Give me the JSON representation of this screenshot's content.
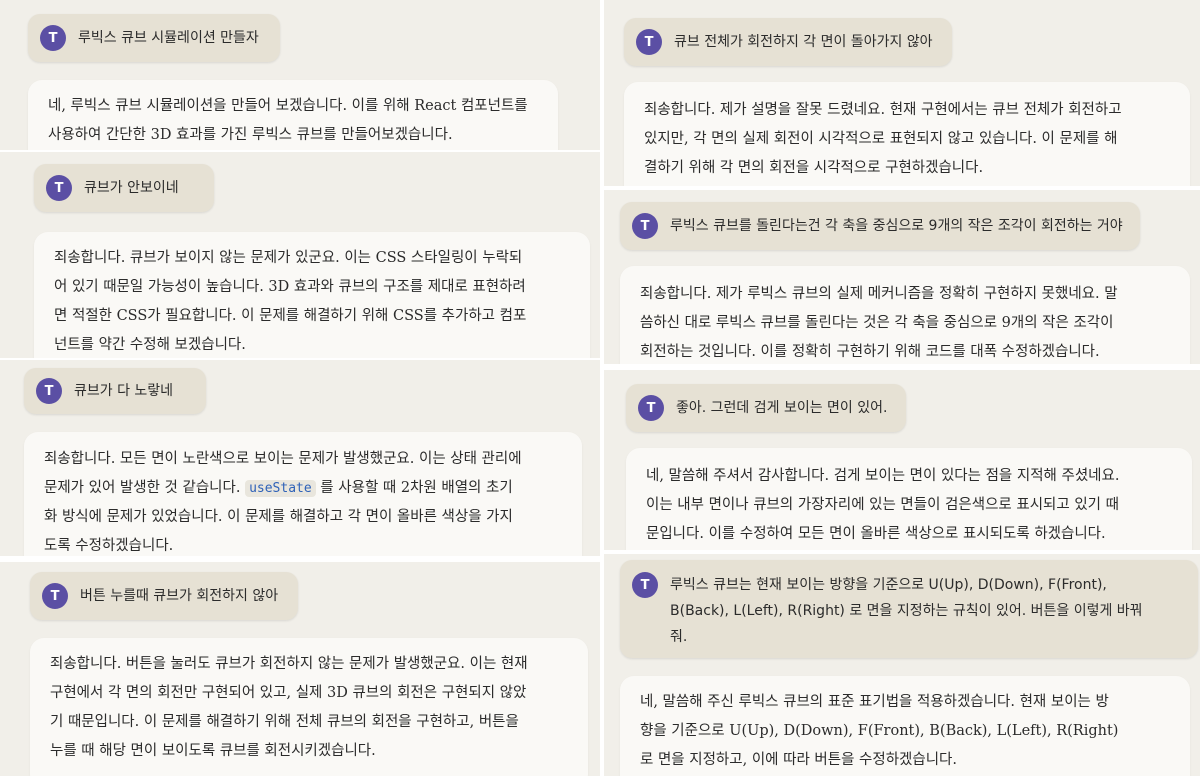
{
  "avatar": {
    "initial": "T"
  },
  "panels": [
    {
      "user": "루빅스 큐브 시뮬레이션 만들자",
      "reply": "네, 루빅스 큐브 시뮬레이션을 만들어 보겠습니다. 이를 위해 React 컴포넌트를\n사용하여 간단한 3D 효과를 가진 루빅스 큐브를 만들어보겠습니다."
    },
    {
      "user": "큐브가 안보이네",
      "reply": "죄송합니다. 큐브가 보이지 않는 문제가 있군요. 이는 CSS 스타일링이 누락되\n어 있기 때문일 가능성이 높습니다. 3D 효과와 큐브의 구조를 제대로 표현하려\n면 적절한 CSS가 필요합니다. 이 문제를 해결하기 위해 CSS를 추가하고 컴포\n넌트를 약간 수정해 보겠습니다."
    },
    {
      "user": "큐브가 다 노랗네",
      "reply_before": "죄송합니다. 모든 면이 노란색으로 보이는 문제가 발생했군요. 이는 상태 관리에\n문제가 있어 발생한 것 같습니다. ",
      "reply_code": "useState",
      "reply_after": " 를 사용할 때 2차원 배열의 초기\n화 방식에 문제가 있었습니다. 이 문제를 해결하고 각 면이 올바른 색상을 가지\n도록 수정하겠습니다."
    },
    {
      "user": "버튼 누를때 큐브가 회전하지 않아",
      "reply": "죄송합니다. 버튼을 눌러도 큐브가 회전하지 않는 문제가 발생했군요. 이는 현재\n구현에서 각 면의 회전만 구현되어 있고, 실제 3D 큐브의 회전은 구현되지 않았\n기 때문입니다. 이 문제를 해결하기 위해 전체 큐브의 회전을 구현하고, 버튼을\n누를 때 해당 면이 보이도록 큐브를 회전시키겠습니다."
    },
    {
      "user": "큐브 전체가 회전하지 각 면이 돌아가지 않아",
      "reply": "죄송합니다. 제가 설명을 잘못 드렸네요. 현재 구현에서는 큐브 전체가 회전하고\n있지만, 각 면의 실제 회전이 시각적으로 표현되지 않고 있습니다. 이 문제를 해\n결하기 위해 각 면의 회전을 시각적으로 구현하겠습니다."
    },
    {
      "user": "루빅스 큐브를 돌린다는건 각 축을 중심으로 9개의 작은 조각이 회전하는 거야",
      "reply": "죄송합니다. 제가 루빅스 큐브의 실제 메커니즘을 정확히 구현하지 못했네요. 말\n씀하신 대로 루빅스 큐브를 돌린다는 것은 각 축을 중심으로 9개의 작은 조각이\n회전하는 것입니다. 이를 정확히 구현하기 위해 코드를 대폭 수정하겠습니다."
    },
    {
      "user": "좋아. 그런데 검게 보이는 면이 있어.",
      "reply": "네, 말씀해 주셔서 감사합니다. 검게 보이는 면이 있다는 점을 지적해 주셨네요.\n이는 내부 면이나 큐브의 가장자리에 있는 면들이 검은색으로 표시되고 있기 때\n문입니다. 이를 수정하여 모든 면이 올바른 색상으로 표시되도록 하겠습니다."
    },
    {
      "user": "루빅스 큐브는 현재 보이는 방향을 기준으로 U(Up), D(Down), F(Front),\nB(Back), L(Left), R(Right) 로 면을 지정하는 규칙이 있어. 버튼을 이렇게 바꿔\n줘.",
      "reply": "네, 말씀해 주신 루빅스 큐브의 표준 표기법을 적용하겠습니다. 현재 보이는 방\n향을 기준으로 U(Up), D(Down), F(Front), B(Back), L(Left), R(Right)\n로 면을 지정하고, 이에 따라 버튼을 수정하겠습니다."
    }
  ]
}
